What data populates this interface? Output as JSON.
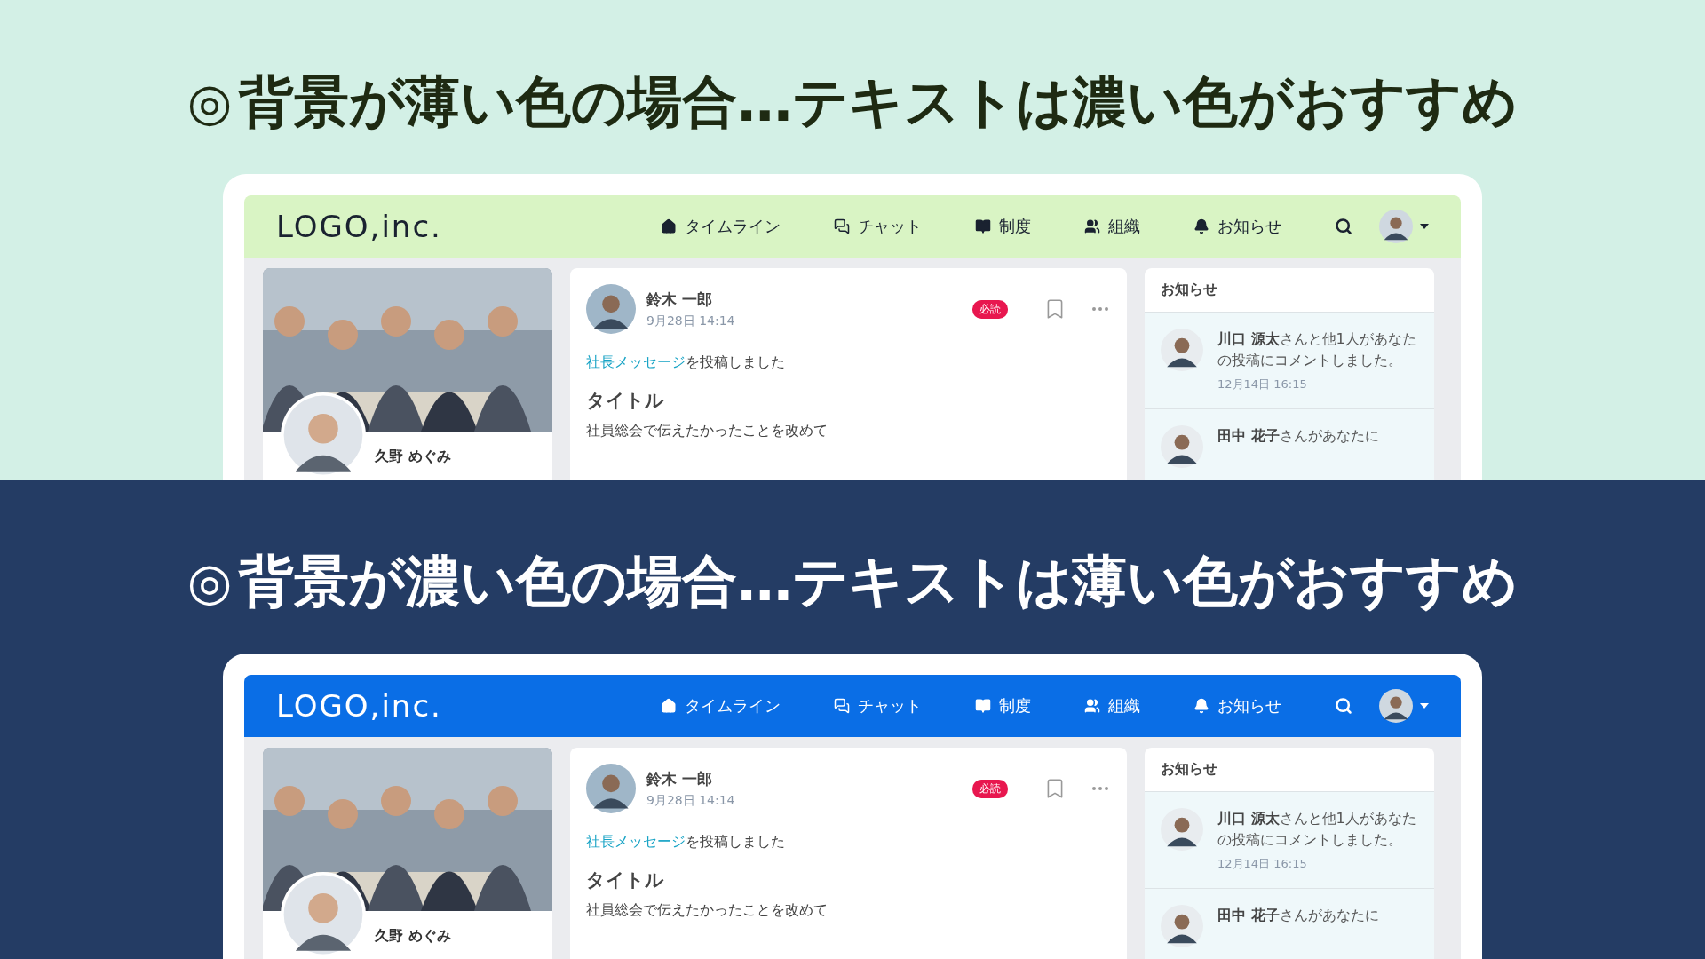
{
  "panels": [
    {
      "kind": "light",
      "mark": "◎",
      "heading": "背景が薄い色の場合…テキストは濃い色がおすすめ",
      "mockup": {
        "logo": "LOGO,inc.",
        "nav": [
          "タイムライン",
          "チャット",
          "制度",
          "組織",
          "お知らせ"
        ],
        "profile": {
          "name": "久野 めぐみ"
        },
        "post": {
          "author": "鈴木 一郎",
          "date": "9月28日 14:14",
          "badge": "必読",
          "link": "社長メッセージ",
          "action": "を投稿しました",
          "title": "タイトル",
          "body": "社員総会で伝えたかったことを改めて"
        },
        "notices": {
          "title": "お知らせ",
          "items": [
            {
              "text": "**川口 源太**さんと他1人があなたの投稿にコメントしました。",
              "time": "12月14日 16:15"
            },
            {
              "text": "**田中 花子**さんがあなたに"
            }
          ]
        }
      }
    },
    {
      "kind": "dark",
      "mark": "◎",
      "heading": "背景が濃い色の場合…テキストは薄い色がおすすめ",
      "mockup": {
        "logo": "LOGO,inc.",
        "nav": [
          "タイムライン",
          "チャット",
          "制度",
          "組織",
          "お知らせ"
        ],
        "profile": {
          "name": "久野 めぐみ"
        },
        "post": {
          "author": "鈴木 一郎",
          "date": "9月28日 14:14",
          "badge": "必読",
          "link": "社長メッセージ",
          "action": "を投稿しました",
          "title": "タイトル",
          "body": "社員総会で伝えたかったことを改めて"
        },
        "notices": {
          "title": "お知らせ",
          "items": [
            {
              "text": "**川口 源太**さんと他1人があなたの投稿にコメントしました。",
              "time": "12月14日 16:15"
            },
            {
              "text": "**田中 花子**さんがあなたに"
            }
          ]
        }
      }
    }
  ]
}
